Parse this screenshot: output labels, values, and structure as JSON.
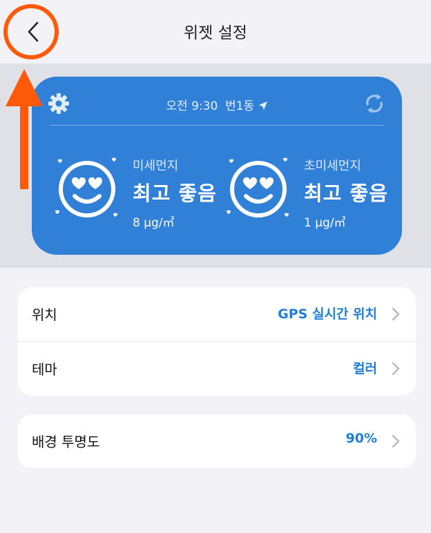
{
  "header": {
    "title": "위젯 설정"
  },
  "widget": {
    "time": "오전 9:30",
    "location": "번1동",
    "fine_dust": {
      "label": "미세먼지",
      "status": "최고 좋음",
      "value": "8 μg/㎥"
    },
    "ultrafine_dust": {
      "label": "초미세먼지",
      "status": "최고 좋음",
      "value": "1 μg/㎥"
    },
    "bg_color": "#2f80d6"
  },
  "settings": {
    "location": {
      "label": "위치",
      "value": "GPS 실시간 위치"
    },
    "theme": {
      "label": "테마",
      "value": "컬러"
    },
    "opacity": {
      "label": "배경 투명도",
      "value": "90%"
    }
  },
  "colors": {
    "accent": "#1e7fd6",
    "annotation": "#ff5a0a"
  },
  "icons": [
    "back-chevron-icon",
    "gear-icon",
    "location-arrow-icon",
    "refresh-icon",
    "smiley-heart-eyes-icon",
    "chevron-right-icon"
  ]
}
